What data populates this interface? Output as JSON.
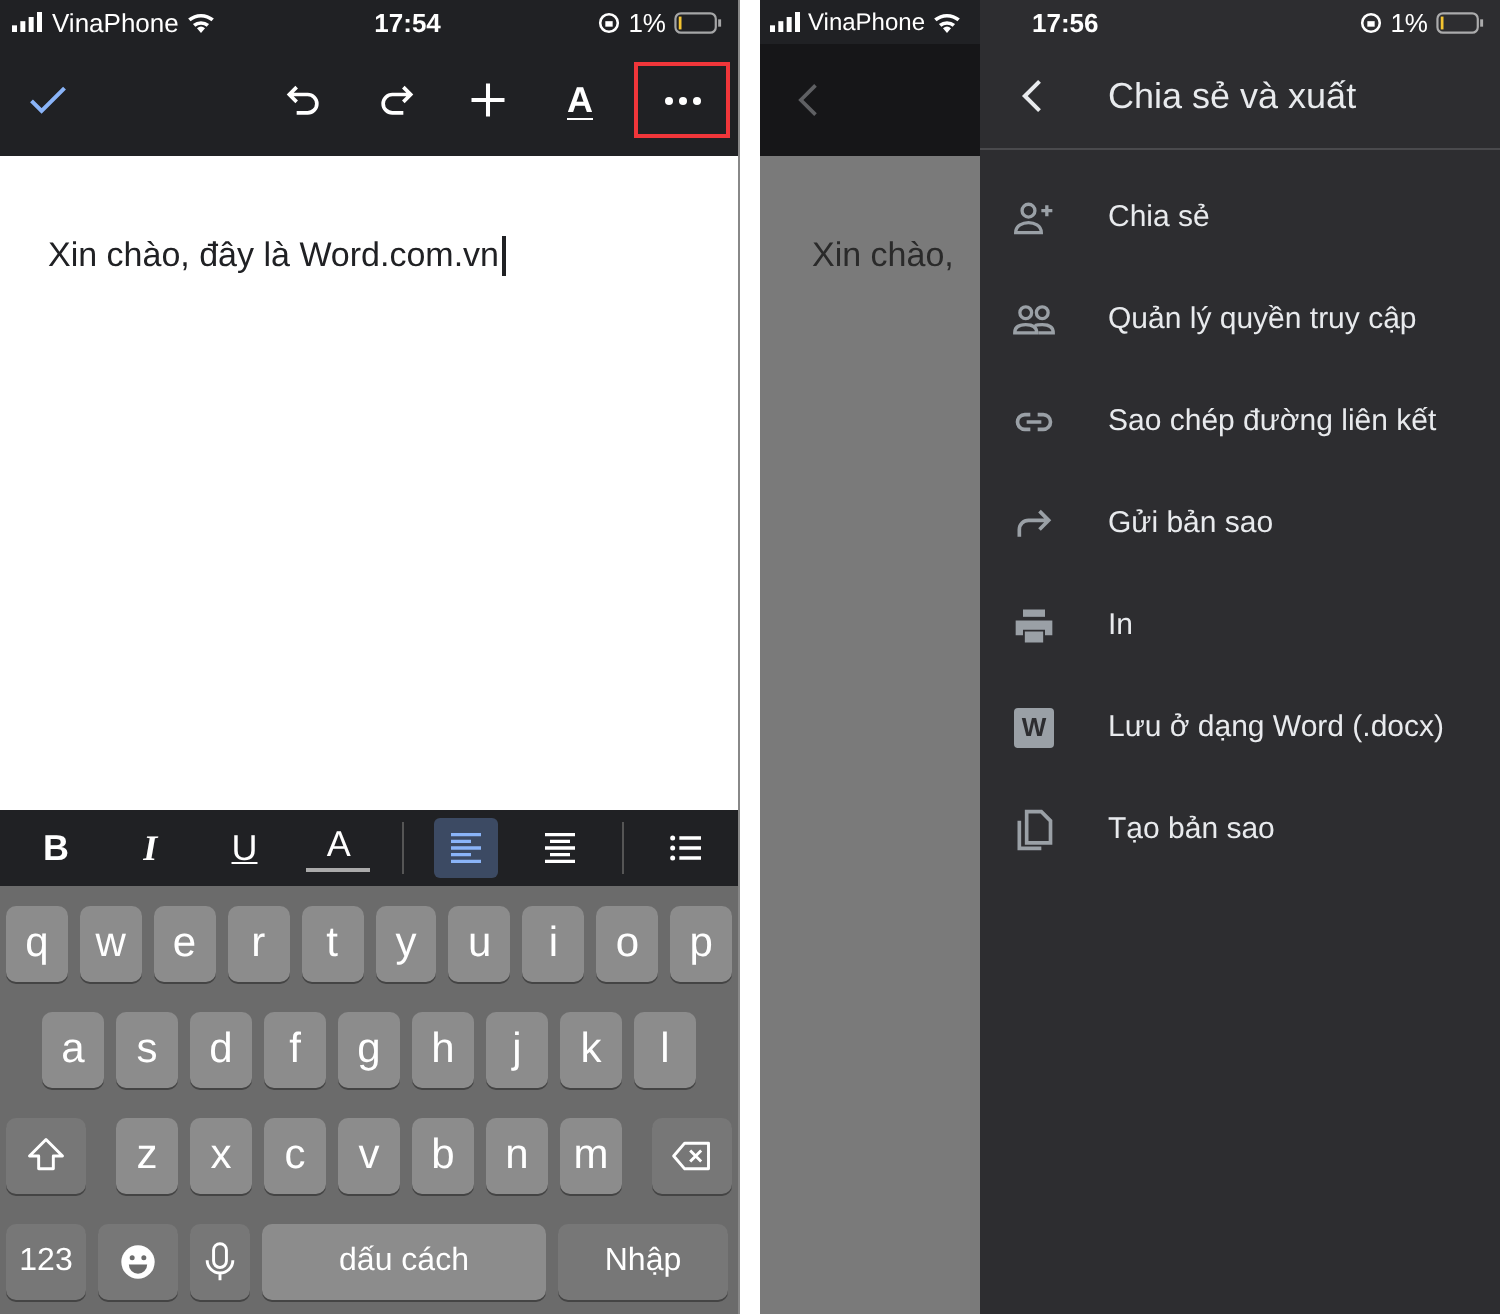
{
  "editor_screen": {
    "status_bar": {
      "carrier": "VinaPhone",
      "time": "17:54",
      "battery": "1%"
    },
    "toolbar": [
      {
        "kind": "check"
      },
      {
        "kind": "undo"
      },
      {
        "kind": "redo"
      },
      {
        "kind": "insert"
      },
      {
        "kind": "text_format",
        "label": "A"
      },
      {
        "kind": "more",
        "highlighted": true
      }
    ],
    "document": {
      "text": "Xin chào, đây là Word.com.vn"
    },
    "format_bar": [
      [
        {
          "kind": "bold",
          "label": "B",
          "selected": false
        },
        {
          "kind": "italic",
          "label": "I",
          "selected": false
        },
        {
          "kind": "underline",
          "label": "U",
          "selected": false
        },
        {
          "kind": "color",
          "label": "A",
          "selected": false
        }
      ],
      [
        {
          "kind": "align_left",
          "selected": true
        },
        {
          "kind": "align_center",
          "selected": false
        }
      ],
      [
        {
          "kind": "list",
          "selected": false
        }
      ]
    ],
    "keyboard": [
      [
        {
          "kind": "letter",
          "label": "q"
        },
        {
          "kind": "letter",
          "label": "w"
        },
        {
          "kind": "letter",
          "label": "e"
        },
        {
          "kind": "letter",
          "label": "r"
        },
        {
          "kind": "letter",
          "label": "t"
        },
        {
          "kind": "letter",
          "label": "y"
        },
        {
          "kind": "letter",
          "label": "u"
        },
        {
          "kind": "letter",
          "label": "i"
        },
        {
          "kind": "letter",
          "label": "o"
        },
        {
          "kind": "letter",
          "label": "p"
        }
      ],
      [
        {
          "kind": "letter",
          "label": "a"
        },
        {
          "kind": "letter",
          "label": "s"
        },
        {
          "kind": "letter",
          "label": "d"
        },
        {
          "kind": "letter",
          "label": "f"
        },
        {
          "kind": "letter",
          "label": "g"
        },
        {
          "kind": "letter",
          "label": "h"
        },
        {
          "kind": "letter",
          "label": "j"
        },
        {
          "kind": "letter",
          "label": "k"
        },
        {
          "kind": "letter",
          "label": "l"
        }
      ],
      [
        {
          "kind": "shift"
        },
        {
          "kind": "letter",
          "label": "z"
        },
        {
          "kind": "letter",
          "label": "x"
        },
        {
          "kind": "letter",
          "label": "c"
        },
        {
          "kind": "letter",
          "label": "v"
        },
        {
          "kind": "letter",
          "label": "b"
        },
        {
          "kind": "letter",
          "label": "n"
        },
        {
          "kind": "letter",
          "label": "m"
        },
        {
          "kind": "backspace"
        }
      ],
      [
        {
          "kind": "mode",
          "label": "123"
        },
        {
          "kind": "emoji"
        },
        {
          "kind": "mic"
        },
        {
          "kind": "space",
          "label": "dấu cách"
        },
        {
          "kind": "return",
          "label": "Nhập"
        }
      ]
    ]
  },
  "share_screen": {
    "status_bar": {
      "carrier": "VinaPhone",
      "time": "17:56",
      "battery": "1%"
    },
    "background_text": "Xin chào,",
    "menu": {
      "title": "Chia sẻ và xuất",
      "items": [
        {
          "kind": "share",
          "label": "Chia sẻ"
        },
        {
          "kind": "access",
          "label": "Quản lý quyền truy cập"
        },
        {
          "kind": "copy_link",
          "label": "Sao chép đường liên kết"
        },
        {
          "kind": "send",
          "label": "Gửi bản sao"
        },
        {
          "kind": "print",
          "label": "In"
        },
        {
          "kind": "word",
          "icon_letter": "W",
          "label": "Lưu ở dạng Word (.docx)"
        },
        {
          "kind": "duplicate",
          "label": "Tạo bản sao"
        }
      ]
    }
  }
}
